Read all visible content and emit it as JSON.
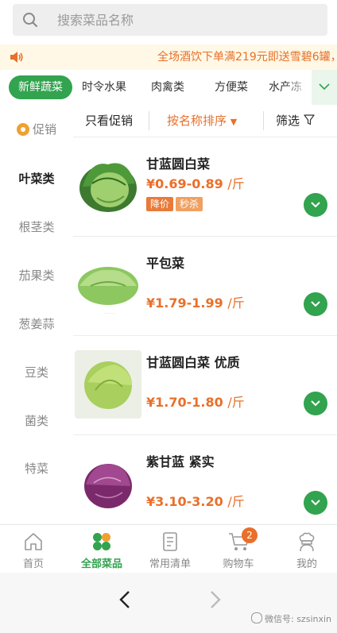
{
  "search": {
    "placeholder": "搜索菜品名称",
    "value": ""
  },
  "promo": {
    "text": "全场酒饮下单满219元即送雪碧6罐，"
  },
  "category_tabs": [
    {
      "label": "新鲜蔬菜",
      "active": true
    },
    {
      "label": "时令水果",
      "active": false
    },
    {
      "label": "肉禽类",
      "active": false
    },
    {
      "label": "方便菜",
      "active": false
    },
    {
      "label": "水产冻",
      "active": false
    }
  ],
  "filter": {
    "promo_only": "只看促销",
    "sort_label": "按名称排序",
    "sort_arrow": "▼",
    "filter_label": "筛选"
  },
  "side_categories": [
    {
      "label": "促销",
      "active": false
    },
    {
      "label": "叶菜类",
      "active": true
    },
    {
      "label": "根茎类",
      "active": false
    },
    {
      "label": "茄果类",
      "active": false
    },
    {
      "label": "葱姜蒜",
      "active": false
    },
    {
      "label": "豆类",
      "active": false
    },
    {
      "label": "菌类",
      "active": false
    },
    {
      "label": "特菜",
      "active": false
    }
  ],
  "products": [
    {
      "name": "甘蓝圆白菜",
      "price": "¥0.69-0.89",
      "unit": "/斤",
      "tags": [
        "降价",
        "秒杀"
      ],
      "image": "green-cabbage"
    },
    {
      "name": "平包菜",
      "price": "¥1.79-1.99",
      "unit": "/斤",
      "tags": [],
      "image": "flat-cabbage"
    },
    {
      "name": "甘蓝圆白菜 优质",
      "price": "¥1.70-1.80",
      "unit": "/斤",
      "tags": [],
      "image": "round-cabbage"
    },
    {
      "name": "紫甘蓝 紧实",
      "price": "¥3.10-3.20",
      "unit": "/斤",
      "tags": [],
      "image": "purple-cabbage"
    }
  ],
  "bottom_nav": [
    {
      "label": "首页",
      "icon": "home-icon",
      "active": false
    },
    {
      "label": "全部菜品",
      "icon": "grid-dots-icon",
      "active": true
    },
    {
      "label": "常用清单",
      "icon": "list-icon",
      "active": false
    },
    {
      "label": "购物车",
      "icon": "cart-icon",
      "active": false,
      "badge": "2"
    },
    {
      "label": "我的",
      "icon": "chef-icon",
      "active": false
    }
  ],
  "watermark": "微信号: szsinxin",
  "colors": {
    "accent": "#32a34e",
    "price": "#e8702a",
    "promo_bg": "#fff8e6"
  }
}
